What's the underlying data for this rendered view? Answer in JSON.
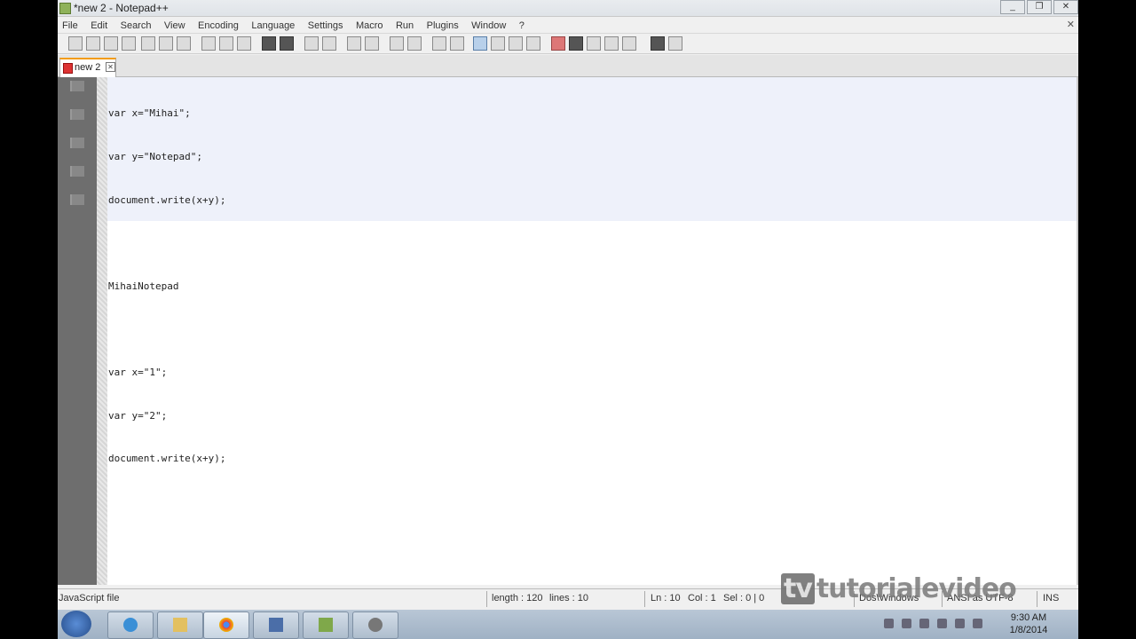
{
  "window": {
    "title": "*new  2 - Notepad++",
    "controls": [
      "_",
      "❐",
      "✕"
    ]
  },
  "menu": [
    "File",
    "Edit",
    "Search",
    "View",
    "Encoding",
    "Language",
    "Settings",
    "Macro",
    "Run",
    "Plugins",
    "Window",
    "?"
  ],
  "menu_close": "✕",
  "tab": {
    "label": "new  2",
    "close": "✕"
  },
  "editor": {
    "lines": [
      "var x=\"Mihai\";",
      "var y=\"Notepad\";",
      "document.write(x+y);",
      "",
      "MihaiNotepad",
      "",
      "var x=\"1\";",
      "var y=\"2\";",
      "document.write(x+y);",
      ""
    ]
  },
  "status": {
    "file_type": "JavaScript file",
    "length": "length : 120",
    "lines": "lines : 10",
    "ln": "Ln : 10",
    "col": "Col : 1",
    "sel": "Sel : 0 | 0",
    "eol": "Dos\\Windows",
    "encoding": "ANSI as UTF-8",
    "mode": "INS"
  },
  "watermark": {
    "tv": "tv",
    "text": "tutorialevideo"
  },
  "taskbar": {
    "clock_time": "9:30 AM",
    "clock_date": "1/8/2014",
    "items": [
      "start-orb",
      "internet-explorer",
      "file-explorer",
      "chrome",
      "network",
      "notepadpp",
      "media-app"
    ]
  }
}
